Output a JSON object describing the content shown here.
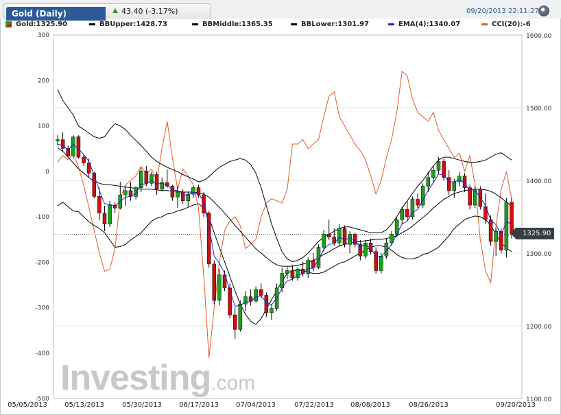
{
  "header": {
    "instrument": "Gold (Daily)",
    "change": "43.40 (-3.17%)",
    "timestamp": "09/20/2013 22:11:27",
    "up_color": "#1e9a1e",
    "tab_color": "#2c5a96"
  },
  "legend": [
    {
      "label": "Gold:1325.90",
      "color": "#1a9a1a",
      "swatch": "flag"
    },
    {
      "label": "BBUpper:1428.73",
      "color": "#000000"
    },
    {
      "label": "BBMiddle:1365.35",
      "color": "#000000"
    },
    {
      "label": "BBLower:1301.97",
      "color": "#000000"
    },
    {
      "label": "EMA(4):1340.07",
      "color": "#1c22c8"
    },
    {
      "label": "CCI(20):-6",
      "color": "#e5572a"
    }
  ],
  "last_price": "1325.90",
  "watermark": {
    "main": "Investing",
    "suffix": ".com"
  },
  "chart_data": {
    "type": "candlestick",
    "x_ticks": [
      "05/05/2013",
      "05/13/2013",
      "05/30/2013",
      "06/17/2013",
      "07/04/2013",
      "07/22/2013",
      "08/08/2013",
      "08/26/2013",
      "09/20/2013"
    ],
    "price_axis": {
      "side": "right",
      "ylim": [
        1100,
        1600
      ],
      "ticks": [
        "1600.00",
        "1500.00",
        "1400.00",
        "1300.00",
        "1200.00",
        "1100.00"
      ]
    },
    "cci_axis": {
      "side": "left",
      "ylim": [
        -500,
        300
      ],
      "ticks": [
        "300",
        "200",
        "100",
        "0",
        "-100",
        "-200",
        "-300",
        "-400",
        "-500"
      ]
    },
    "colors": {
      "up": "#1ea01e",
      "down": "#cc1111",
      "bb": "#000000",
      "ema": "#1c22c8",
      "cci": "#e5572a",
      "last_line": "#555555"
    },
    "last_close": 1325.9,
    "ohlc": [
      [
        1454,
        1462,
        1448,
        1456
      ],
      [
        1456,
        1466,
        1440,
        1444
      ],
      [
        1444,
        1448,
        1432,
        1434
      ],
      [
        1434,
        1462,
        1430,
        1460
      ],
      [
        1460,
        1462,
        1430,
        1432
      ],
      [
        1432,
        1436,
        1420,
        1424
      ],
      [
        1424,
        1430,
        1405,
        1410
      ],
      [
        1410,
        1412,
        1375,
        1378
      ],
      [
        1378,
        1390,
        1345,
        1355
      ],
      [
        1355,
        1365,
        1330,
        1340
      ],
      [
        1340,
        1372,
        1336,
        1366
      ],
      [
        1366,
        1370,
        1355,
        1362
      ],
      [
        1362,
        1398,
        1360,
        1380
      ],
      [
        1380,
        1392,
        1365,
        1386
      ],
      [
        1386,
        1398,
        1372,
        1378
      ],
      [
        1378,
        1392,
        1374,
        1390
      ],
      [
        1390,
        1418,
        1384,
        1413
      ],
      [
        1413,
        1420,
        1392,
        1396
      ],
      [
        1396,
        1412,
        1392,
        1408
      ],
      [
        1408,
        1412,
        1380,
        1388
      ],
      [
        1388,
        1404,
        1385,
        1397
      ],
      [
        1397,
        1415,
        1390,
        1392
      ],
      [
        1392,
        1394,
        1372,
        1377
      ],
      [
        1377,
        1392,
        1362,
        1384
      ],
      [
        1384,
        1388,
        1368,
        1372
      ],
      [
        1372,
        1384,
        1364,
        1381
      ],
      [
        1381,
        1392,
        1376,
        1390
      ],
      [
        1390,
        1394,
        1376,
        1380
      ],
      [
        1380,
        1384,
        1350,
        1355
      ],
      [
        1355,
        1358,
        1280,
        1285
      ],
      [
        1285,
        1290,
        1230,
        1235
      ],
      [
        1235,
        1278,
        1228,
        1270
      ],
      [
        1270,
        1276,
        1248,
        1252
      ],
      [
        1252,
        1258,
        1210,
        1215
      ],
      [
        1215,
        1225,
        1182,
        1195
      ],
      [
        1195,
        1235,
        1192,
        1230
      ],
      [
        1230,
        1248,
        1220,
        1240
      ],
      [
        1240,
        1250,
        1228,
        1234
      ],
      [
        1234,
        1254,
        1232,
        1250
      ],
      [
        1250,
        1258,
        1238,
        1242
      ],
      [
        1242,
        1246,
        1212,
        1218
      ],
      [
        1218,
        1230,
        1208,
        1224
      ],
      [
        1224,
        1258,
        1220,
        1252
      ],
      [
        1252,
        1280,
        1246,
        1272
      ],
      [
        1272,
        1282,
        1264,
        1276
      ],
      [
        1276,
        1284,
        1262,
        1266
      ],
      [
        1266,
        1280,
        1262,
        1278
      ],
      [
        1278,
        1288,
        1268,
        1272
      ],
      [
        1272,
        1294,
        1266,
        1290
      ],
      [
        1290,
        1300,
        1275,
        1280
      ],
      [
        1280,
        1312,
        1278,
        1308
      ],
      [
        1308,
        1332,
        1302,
        1326
      ],
      [
        1326,
        1346,
        1318,
        1322
      ],
      [
        1322,
        1334,
        1310,
        1314
      ],
      [
        1314,
        1340,
        1310,
        1334
      ],
      [
        1334,
        1338,
        1308,
        1312
      ],
      [
        1312,
        1330,
        1300,
        1326
      ],
      [
        1326,
        1328,
        1308,
        1312
      ],
      [
        1312,
        1318,
        1290,
        1296
      ],
      [
        1296,
        1318,
        1292,
        1314
      ],
      [
        1314,
        1320,
        1298,
        1302
      ],
      [
        1302,
        1308,
        1272,
        1276
      ],
      [
        1276,
        1300,
        1272,
        1296
      ],
      [
        1296,
        1320,
        1292,
        1314
      ],
      [
        1314,
        1330,
        1310,
        1326
      ],
      [
        1326,
        1350,
        1322,
        1346
      ],
      [
        1346,
        1364,
        1340,
        1360
      ],
      [
        1360,
        1372,
        1344,
        1350
      ],
      [
        1350,
        1378,
        1346,
        1374
      ],
      [
        1374,
        1382,
        1362,
        1366
      ],
      [
        1366,
        1396,
        1362,
        1392
      ],
      [
        1392,
        1412,
        1384,
        1404
      ],
      [
        1404,
        1420,
        1396,
        1414
      ],
      [
        1414,
        1432,
        1408,
        1426
      ],
      [
        1426,
        1430,
        1400,
        1404
      ],
      [
        1404,
        1414,
        1380,
        1386
      ],
      [
        1386,
        1402,
        1376,
        1398
      ],
      [
        1398,
        1412,
        1392,
        1406
      ],
      [
        1406,
        1410,
        1384,
        1390
      ],
      [
        1390,
        1394,
        1360,
        1366
      ],
      [
        1366,
        1392,
        1362,
        1388
      ],
      [
        1388,
        1392,
        1360,
        1364
      ],
      [
        1364,
        1382,
        1340,
        1346
      ],
      [
        1346,
        1352,
        1310,
        1316
      ],
      [
        1316,
        1334,
        1296,
        1330
      ],
      [
        1330,
        1334,
        1300,
        1304
      ],
      [
        1304,
        1376,
        1294,
        1370
      ],
      [
        1370,
        1376,
        1320,
        1326
      ]
    ],
    "bb_upper": [
      1525,
      1510,
      1500,
      1490,
      1475,
      1470,
      1465,
      1460,
      1458,
      1460,
      1470,
      1478,
      1475,
      1470,
      1462,
      1455,
      1448,
      1440,
      1432,
      1426,
      1422,
      1418,
      1415,
      1412,
      1408,
      1405,
      1402,
      1398,
      1400,
      1405,
      1412,
      1418,
      1422,
      1426,
      1428,
      1430,
      1428,
      1422,
      1410,
      1390,
      1365,
      1340,
      1320,
      1302,
      1292,
      1288,
      1290,
      1294,
      1300,
      1308,
      1316,
      1322,
      1326,
      1330,
      1334,
      1336,
      1336,
      1334,
      1332,
      1330,
      1328,
      1328,
      1328,
      1332,
      1340,
      1350,
      1362,
      1372,
      1382,
      1392,
      1400,
      1410,
      1420,
      1428,
      1432,
      1432,
      1430,
      1428,
      1426,
      1425,
      1425,
      1426,
      1428,
      1432,
      1436,
      1438,
      1433,
      1428
    ],
    "bb_middle": [
      1445,
      1440,
      1432,
      1424,
      1416,
      1410,
      1404,
      1399,
      1396,
      1394,
      1394,
      1393,
      1392,
      1391,
      1390,
      1389,
      1388,
      1388,
      1388,
      1387,
      1386,
      1386,
      1385,
      1385,
      1384,
      1384,
      1384,
      1383,
      1381,
      1377,
      1370,
      1363,
      1355,
      1347,
      1338,
      1330,
      1322,
      1314,
      1306,
      1300,
      1294,
      1288,
      1284,
      1282,
      1282,
      1282,
      1283,
      1285,
      1287,
      1290,
      1294,
      1298,
      1302,
      1306,
      1310,
      1312,
      1314,
      1315,
      1316,
      1317,
      1318,
      1319,
      1319,
      1320,
      1322,
      1324,
      1328,
      1332,
      1337,
      1343,
      1349,
      1355,
      1362,
      1368,
      1374,
      1378,
      1382,
      1384,
      1386,
      1387,
      1388,
      1388,
      1387,
      1385,
      1381,
      1376,
      1370,
      1365
    ],
    "bb_lower": [
      1365,
      1370,
      1364,
      1358,
      1357,
      1350,
      1343,
      1338,
      1334,
      1328,
      1318,
      1308,
      1309,
      1312,
      1318,
      1323,
      1328,
      1336,
      1344,
      1348,
      1350,
      1354,
      1355,
      1358,
      1360,
      1363,
      1366,
      1368,
      1362,
      1349,
      1328,
      1308,
      1288,
      1268,
      1248,
      1230,
      1216,
      1206,
      1202,
      1210,
      1223,
      1236,
      1248,
      1262,
      1272,
      1276,
      1276,
      1276,
      1274,
      1272,
      1272,
      1274,
      1278,
      1282,
      1286,
      1288,
      1292,
      1296,
      1300,
      1304,
      1308,
      1310,
      1310,
      1308,
      1304,
      1298,
      1294,
      1292,
      1292,
      1294,
      1298,
      1300,
      1304,
      1308,
      1316,
      1324,
      1334,
      1340,
      1346,
      1349,
      1351,
      1350,
      1346,
      1338,
      1326,
      1314,
      1307,
      1302
    ],
    "ema4": [
      1450,
      1448,
      1442,
      1450,
      1443,
      1436,
      1426,
      1407,
      1386,
      1368,
      1367,
      1365,
      1371,
      1377,
      1378,
      1382,
      1395,
      1395,
      1400,
      1395,
      1396,
      1394,
      1387,
      1386,
      1380,
      1380,
      1384,
      1382,
      1371,
      1337,
      1296,
      1286,
      1272,
      1249,
      1227,
      1228,
      1233,
      1233,
      1240,
      1241,
      1232,
      1229,
      1238,
      1252,
      1262,
      1264,
      1270,
      1271,
      1279,
      1279,
      1291,
      1305,
      1312,
      1313,
      1322,
      1318,
      1321,
      1317,
      1309,
      1311,
      1307,
      1295,
      1295,
      1303,
      1312,
      1326,
      1340,
      1344,
      1356,
      1360,
      1373,
      1386,
      1397,
      1409,
      1407,
      1398,
      1398,
      1401,
      1397,
      1385,
      1386,
      1377,
      1365,
      1345,
      1339,
      1325,
      1343,
      1340
    ],
    "cci": [
      20,
      35,
      25,
      40,
      10,
      -30,
      -80,
      -130,
      -180,
      -220,
      -215,
      -170,
      -60,
      -30,
      -20,
      -10,
      10,
      -5,
      5,
      -20,
      50,
      110,
      30,
      -40,
      5,
      -10,
      -30,
      -80,
      -230,
      -410,
      -300,
      -200,
      -130,
      -110,
      -100,
      -120,
      -170,
      -160,
      -150,
      -100,
      -70,
      -60,
      -65,
      -70,
      -40,
      60,
      60,
      70,
      50,
      60,
      70,
      120,
      165,
      175,
      120,
      100,
      80,
      60,
      45,
      25,
      -10,
      -50,
      -20,
      30,
      70,
      130,
      220,
      210,
      160,
      130,
      120,
      110,
      130,
      90,
      70,
      50,
      30,
      40,
      0,
      35,
      -30,
      -150,
      -220,
      -245,
      -120,
      -40,
      0,
      -60
    ]
  }
}
